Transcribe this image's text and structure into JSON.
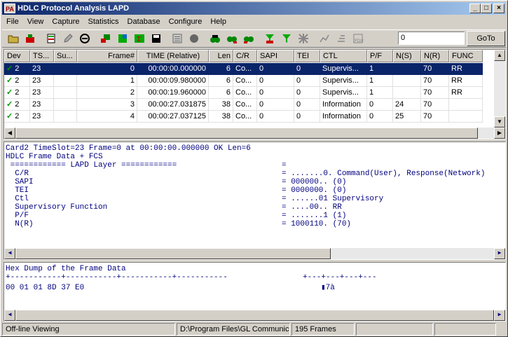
{
  "title": "HDLC Protocol Analysis LAPD",
  "menu": [
    "File",
    "View",
    "Capture",
    "Statistics",
    "Database",
    "Configure",
    "Help"
  ],
  "goto": {
    "input_value": "0",
    "button_label": "GoTo"
  },
  "columns": [
    "Dev",
    "TS...",
    "Su...",
    "Frame#",
    "TIME (Relative)",
    "Len",
    "C/R",
    "SAPI",
    "TEI",
    "CTL",
    "P/F",
    "N(S)",
    "N(R)",
    "FUNC"
  ],
  "rows": [
    {
      "dev": "2",
      "ts": "23",
      "su": "",
      "frame": "0",
      "time": "00:00:00.000000",
      "len": "6",
      "cr": "Co...",
      "sapi": "0",
      "tei": "0",
      "ctl": "Supervis...",
      "pf": "1",
      "ns": "",
      "nr": "70",
      "func": "RR"
    },
    {
      "dev": "2",
      "ts": "23",
      "su": "",
      "frame": "1",
      "time": "00:00:09.980000",
      "len": "6",
      "cr": "Co...",
      "sapi": "0",
      "tei": "0",
      "ctl": "Supervis...",
      "pf": "1",
      "ns": "",
      "nr": "70",
      "func": "RR"
    },
    {
      "dev": "2",
      "ts": "23",
      "su": "",
      "frame": "2",
      "time": "00:00:19.960000",
      "len": "6",
      "cr": "Co...",
      "sapi": "0",
      "tei": "0",
      "ctl": "Supervis...",
      "pf": "1",
      "ns": "",
      "nr": "70",
      "func": "RR"
    },
    {
      "dev": "2",
      "ts": "23",
      "su": "",
      "frame": "3",
      "time": "00:00:27.031875",
      "len": "38",
      "cr": "Co...",
      "sapi": "0",
      "tei": "0",
      "ctl": "Information",
      "pf": "0",
      "ns": "24",
      "nr": "70",
      "func": ""
    },
    {
      "dev": "2",
      "ts": "23",
      "su": "",
      "frame": "4",
      "time": "00:00:27.037125",
      "len": "38",
      "cr": "Co...",
      "sapi": "0",
      "tei": "0",
      "ctl": "Information",
      "pf": "0",
      "ns": "25",
      "nr": "70",
      "func": ""
    }
  ],
  "detail": {
    "header1": "Card2 TimeSlot=23 Frame=0 at 00:00:00.000000 OK Len=6",
    "header2": "HDLC Frame Data + FCS",
    "layer": " ============ LAPD Layer ============",
    "layer_eq": "=",
    "fields": [
      {
        "name": "  C/R",
        "value": "= .......0. Command(User), Response(Network)"
      },
      {
        "name": "  SAPI",
        "value": "= 000000.. (0)"
      },
      {
        "name": "  TEI",
        "value": "= 0000000. (0)"
      },
      {
        "name": "  Ctl",
        "value": "= ......01 Supervisory"
      },
      {
        "name": "  Supervisory Function",
        "value": "= ....00.. RR"
      },
      {
        "name": "  P/F",
        "value": "= .......1 (1)"
      },
      {
        "name": "  N(R)",
        "value": "= 1000110. (70)"
      }
    ]
  },
  "hex": {
    "title": "Hex Dump of the Frame Data",
    "ruler": "+-----------+-----------+-----------+-----------",
    "ruler2": "+---+---+---+---",
    "bytes": "00 01 01 8D 37 E0",
    "ascii": "▮7à"
  },
  "status": {
    "mode": "Off-line Viewing",
    "path": "D:\\Program Files\\GL Communicat",
    "frames": "195 Frames"
  }
}
